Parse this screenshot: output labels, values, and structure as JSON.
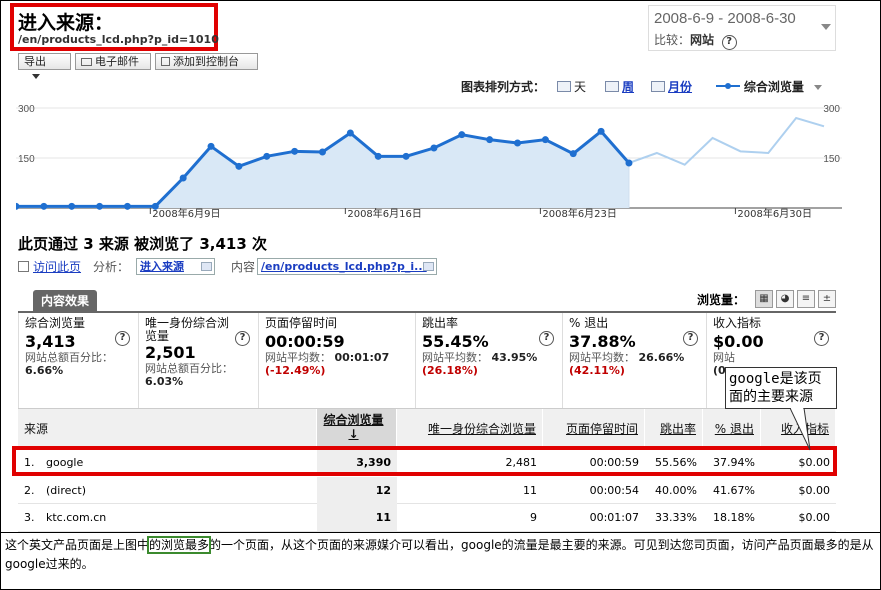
{
  "title": {
    "main": "进入来源：",
    "url": "/en/products_lcd.php?p_id=1010"
  },
  "date_range": {
    "range": "2008-6-9 - 2008-6-30",
    "compare_label": "比较：",
    "compare_value": "网站"
  },
  "toolbar": {
    "export": "导出",
    "email": "电子邮件",
    "add_dashboard": "添加到控制台"
  },
  "chart_options": {
    "label": "图表排列方式：",
    "day": "天",
    "week": "周",
    "month": "月份",
    "metric": "综合浏览量"
  },
  "chart_data": {
    "type": "line",
    "ylim": [
      0,
      300
    ],
    "yticks": [
      "300",
      "150"
    ],
    "xticks": [
      "2008年6月9日",
      "2008年6月16日",
      "2008年6月23日",
      "2008年6月30日"
    ],
    "series": [
      {
        "values": [
          5,
          5,
          5,
          5,
          5,
          5,
          90,
          185,
          125,
          155,
          170,
          168,
          225,
          155,
          155,
          180,
          220,
          205,
          195,
          205,
          163,
          230,
          135,
          165,
          130,
          210,
          170,
          165,
          270,
          245
        ]
      }
    ],
    "colors": {
      "line": "#1f6fd0",
      "fill": "#d9e8f6",
      "future": "#aed0ef"
    }
  },
  "summary": {
    "heading": "此页通过 3 来源 被浏览了 3,413 次",
    "visit_page": "访问此页",
    "analysis_label": "分析：",
    "analysis_value": "进入来源",
    "content_label": "内容",
    "content_value": "/en/products_lcd.php?p_i..."
  },
  "content_tab": "内容效果",
  "view_label": "浏览量：",
  "metrics": [
    {
      "label": "综合浏览量",
      "value": "3,413",
      "sub1": "网站总额百分比：",
      "sub2": "6.66%",
      "sub3": ""
    },
    {
      "label": "唯一身份综合浏览量",
      "value": "2,501",
      "sub1": "网站总额百分比：",
      "sub2": "6.03%",
      "sub3": ""
    },
    {
      "label": "页面停留时间",
      "value": "00:00:59",
      "sub1": "网站平均数：",
      "sub2": "00:01:07",
      "sub3": "(-12.49%)"
    },
    {
      "label": "跳出率",
      "value": "55.45%",
      "sub1": "网站平均数：",
      "sub2": "43.95%",
      "sub3": "(26.18%)"
    },
    {
      "label": "% 退出",
      "value": "37.88%",
      "sub1": "网站平均数：",
      "sub2": "26.66%",
      "sub3": "(42.11%)"
    },
    {
      "label": "收入指标",
      "value": "$0.00",
      "sub1": "网站",
      "sub2": "(0.",
      "sub3": ""
    }
  ],
  "table": {
    "headers": [
      "来源",
      "综合浏览量",
      "唯一身份综合浏览量",
      "页面停留时间",
      "跳出率",
      "% 退出",
      "收入指标"
    ],
    "rows": [
      {
        "idx": "1.",
        "source": "google",
        "pv": "3,390",
        "upv": "2,481",
        "time": "00:00:59",
        "bounce": "55.56%",
        "exit": "37.94%",
        "rev": "$0.00"
      },
      {
        "idx": "2.",
        "source": "(direct)",
        "pv": "12",
        "upv": "11",
        "time": "00:00:54",
        "bounce": "40.00%",
        "exit": "41.67%",
        "rev": "$0.00"
      },
      {
        "idx": "3.",
        "source": "ktc.com.cn",
        "pv": "11",
        "upv": "9",
        "time": "00:01:07",
        "bounce": "33.33%",
        "exit": "18.18%",
        "rev": "$0.00"
      }
    ]
  },
  "callout": "google是该页面的主要来源",
  "caption": {
    "part1": "这个英文产品页面是上图中",
    "highlight": "的浏览最多",
    "part2": "的一个页面，从这个页面的来源媒介可以看出，google的流量是最主要的来源。可见到达您司页面，访问产品页面最多的是从google过来的。"
  }
}
